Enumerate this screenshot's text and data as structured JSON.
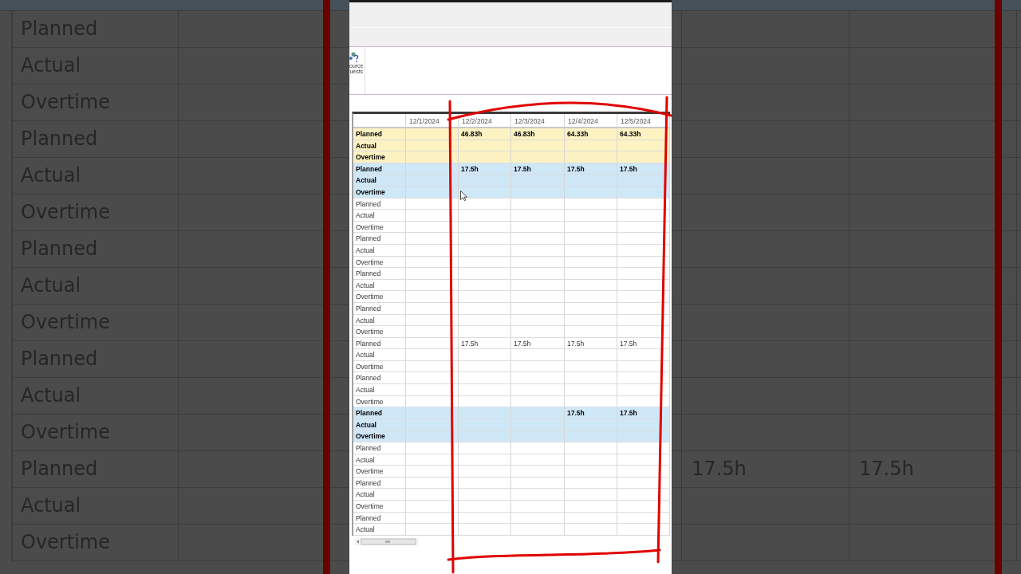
{
  "backdrop_left": {
    "labels": [
      "Planned",
      "Actual",
      "Overtime",
      "Planned",
      "Actual",
      "Overtime",
      "Planned",
      "Actual",
      "Overtime",
      "Planned",
      "Actual",
      "Overtime",
      "Planned",
      "Actual",
      "Overtime"
    ]
  },
  "backdrop_right": {
    "rows": [
      {
        "kind": "blank"
      },
      {
        "kind": "blank"
      },
      {
        "kind": "blank"
      },
      {
        "kind": "blank"
      },
      {
        "kind": "blank"
      },
      {
        "kind": "blank"
      },
      {
        "kind": "blank"
      },
      {
        "kind": "blank"
      },
      {
        "kind": "blank"
      },
      {
        "kind": "blank"
      },
      {
        "kind": "blank"
      },
      {
        "kind": "blank"
      },
      {
        "kind": "values",
        "cells": [
          "17.5h",
          "17.5h"
        ]
      },
      {
        "kind": "blank"
      },
      {
        "kind": "blank"
      }
    ]
  },
  "ribbon": {
    "button": {
      "label_lines": [
        "ource",
        "uests"
      ]
    }
  },
  "sheet": {
    "columns": [
      "12/1/2024",
      "12/2/2024",
      "12/3/2024",
      "12/4/2024",
      "12/5/2024"
    ],
    "groups": [
      {
        "color": "#fcf2c2",
        "bold": true,
        "rows": [
          {
            "label": "Planned",
            "cells": [
              {
                "kind": "empty"
              },
              {
                "kind": "value",
                "text": "46.83h"
              },
              {
                "kind": "value",
                "text": "46.83h"
              },
              {
                "kind": "value",
                "text": "64.33h"
              },
              {
                "kind": "value",
                "text": "64.33h"
              }
            ]
          },
          {
            "label": "Actual"
          },
          {
            "label": "Overtime"
          }
        ]
      },
      {
        "color": "#cfe8f8",
        "bold": true,
        "rows": [
          {
            "label": "Planned",
            "cells": [
              {
                "kind": "empty"
              },
              {
                "kind": "value",
                "text": "17.5h"
              },
              {
                "kind": "value",
                "text": "17.5h"
              },
              {
                "kind": "value",
                "text": "17.5h"
              },
              {
                "kind": "value",
                "text": "17.5h"
              }
            ]
          },
          {
            "label": "Actual"
          },
          {
            "label": "Overtime"
          }
        ]
      },
      {
        "bold": false,
        "rows": [
          {
            "label": "Planned"
          },
          {
            "label": "Actual"
          },
          {
            "label": "Overtime"
          }
        ]
      },
      {
        "bold": false,
        "rows": [
          {
            "label": "Planned"
          },
          {
            "label": "Actual"
          },
          {
            "label": "Overtime"
          }
        ]
      },
      {
        "bold": false,
        "rows": [
          {
            "label": "Planned"
          },
          {
            "label": "Actual"
          },
          {
            "label": "Overtime"
          }
        ]
      },
      {
        "bold": false,
        "rows": [
          {
            "label": "Planned"
          },
          {
            "label": "Actual"
          },
          {
            "label": "Overtime"
          }
        ]
      },
      {
        "bold": false,
        "rows": [
          {
            "label": "Planned",
            "cells": [
              {
                "kind": "empty"
              },
              {
                "kind": "value",
                "text": "17.5h"
              },
              {
                "kind": "value",
                "text": "17.5h"
              },
              {
                "kind": "value",
                "text": "17.5h"
              },
              {
                "kind": "value",
                "text": "17.5h"
              }
            ]
          },
          {
            "label": "Actual"
          },
          {
            "label": "Overtime"
          }
        ]
      },
      {
        "bold": false,
        "rows": [
          {
            "label": "Planned"
          },
          {
            "label": "Actual"
          },
          {
            "label": "Overtime"
          }
        ]
      },
      {
        "color": "#cfe8f8",
        "bold": true,
        "rows": [
          {
            "label": "Planned",
            "cells": [
              {
                "kind": "empty"
              },
              {
                "kind": "empty"
              },
              {
                "kind": "empty"
              },
              {
                "kind": "value",
                "text": "17.5h"
              },
              {
                "kind": "value",
                "text": "17.5h"
              }
            ]
          },
          {
            "label": "Actual"
          },
          {
            "label": "Overtime"
          }
        ]
      },
      {
        "bold": false,
        "rows": [
          {
            "label": "Planned"
          },
          {
            "label": "Actual"
          },
          {
            "label": "Overtime"
          }
        ]
      },
      {
        "bold": false,
        "rows": [
          {
            "label": "Planned"
          },
          {
            "label": "Actual"
          },
          {
            "label": "Overtime"
          }
        ]
      },
      {
        "bold": false,
        "rows": [
          {
            "label": "Planned"
          },
          {
            "label": "Actual"
          }
        ]
      }
    ]
  }
}
